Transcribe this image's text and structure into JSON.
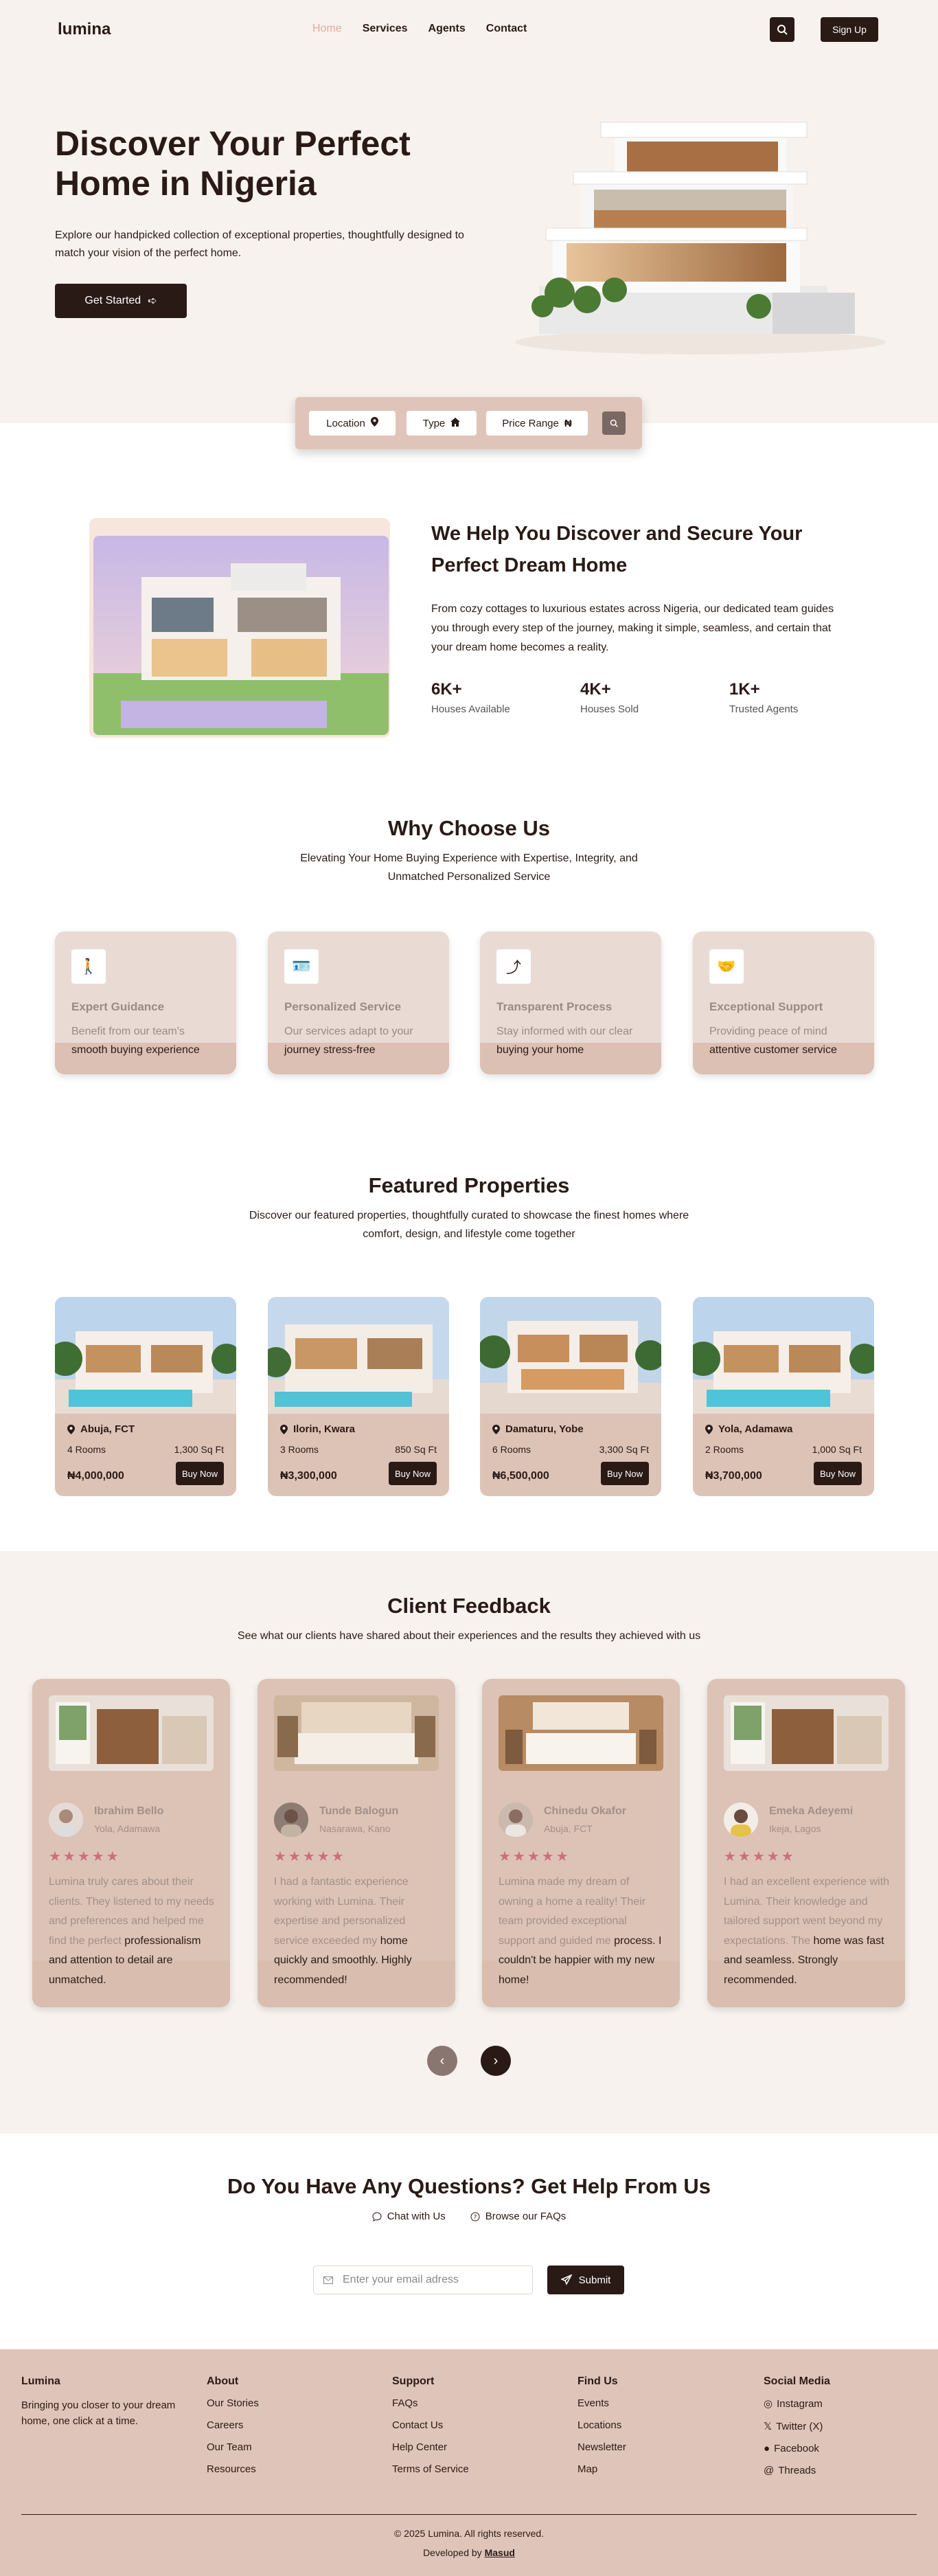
{
  "nav": {
    "logo": "lumina",
    "links": [
      "Home",
      "Services",
      "Agents",
      "Contact"
    ],
    "signup": "Sign Up"
  },
  "hero": {
    "title": "Discover Your Perfect Home in Nigeria",
    "subtitle": "Explore our handpicked collection of exceptional properties, thoughtfully designed to match your vision of the perfect home.",
    "cta": "Get Started"
  },
  "search": {
    "location": "Location",
    "type": "Type",
    "price": "Price Range"
  },
  "about": {
    "title": "We Help You Discover and Secure Your Perfect Dream Home",
    "text": "From cozy cottages to luxurious estates across Nigeria, our dedicated team guides you through every step of the journey, making it simple, seamless, and certain that your dream home becomes a reality.",
    "stats": [
      {
        "num": "6K+",
        "label": "Houses Available"
      },
      {
        "num": "4K+",
        "label": "Houses Sold"
      },
      {
        "num": "1K+",
        "label": "Trusted Agents"
      }
    ]
  },
  "why": {
    "title": "Why Choose Us",
    "subtitle": "Elevating Your Home Buying Experience with Expertise, Integrity, and Unmatched Personalized Service",
    "items": [
      {
        "title": "Expert Guidance",
        "l1": "Benefit from our team's",
        "l2": "smooth buying experience",
        "icon": "walking-arrow-icon"
      },
      {
        "title": "Personalized Service",
        "l1": "Our services adapt to your",
        "l2": "journey stress-free",
        "icon": "id-badge-icon"
      },
      {
        "title": "Transparent Process",
        "l1": "Stay informed with our clear",
        "l2": "buying your home",
        "icon": "route-icon"
      },
      {
        "title": "Exceptional Support",
        "l1": "Providing peace of mind",
        "l2": "attentive customer service",
        "icon": "handshake-icon"
      }
    ]
  },
  "featured": {
    "title": "Featured Properties",
    "subtitle": "Discover our featured properties, thoughtfully curated to showcase the finest homes where comfort, design, and lifestyle come together",
    "buy": "Buy Now",
    "items": [
      {
        "loc": "Abuja, FCT",
        "rooms": "4 Rooms",
        "sqft": "1,300 Sq Ft",
        "price": "₦4,000,000"
      },
      {
        "loc": "Ilorin, Kwara",
        "rooms": "3 Rooms",
        "sqft": "850 Sq Ft",
        "price": "₦3,300,000"
      },
      {
        "loc": "Damaturu, Yobe",
        "rooms": "6 Rooms",
        "sqft": "3,300 Sq Ft",
        "price": "₦6,500,000"
      },
      {
        "loc": "Yola, Adamawa",
        "rooms": "2 Rooms",
        "sqft": "1,000 Sq Ft",
        "price": "₦3,700,000"
      }
    ]
  },
  "feedback": {
    "title": "Client Feedback",
    "subtitle": "See what our clients have shared about their experiences and the results they achieved with us",
    "stars": "★★★★★",
    "items": [
      {
        "name": "Ibrahim Bello",
        "place": "Yola, Adamawa",
        "t1": "Lumina truly cares about their clients. They listened to my needs and preferences and helped me find the perfect",
        "t2": "professionalism and attention to detail are unmatched."
      },
      {
        "name": "Tunde Balogun",
        "place": "Nasarawa, Kano",
        "t1": "I had a fantastic experience working with Lumina. Their expertise and personalized service exceeded my",
        "t2": "home quickly and smoothly. Highly recommended!"
      },
      {
        "name": "Chinedu Okafor",
        "place": "Abuja, FCT",
        "t1": "Lumina made my dream of owning a home a reality! Their team provided exceptional support and guided me",
        "t2": "process. I couldn't be happier with my new home!"
      },
      {
        "name": "Emeka Adeyemi",
        "place": "Ikeja, Lagos",
        "t1": "I had an excellent experience with Lumina. Their knowledge and tailored support went beyond my expectations. The",
        "t2": "home was fast and seamless. Strongly recommended."
      }
    ]
  },
  "faq": {
    "title": "Do You Have Any Questions? Get Help From Us",
    "chat": "Chat with Us",
    "browse": "Browse our FAQs",
    "placeholder": "Enter your email adress",
    "submit": "Submit"
  },
  "footer": {
    "brand": "Lumina",
    "tagline": "Bringing you closer to your dream home, one click at a time.",
    "cols": [
      {
        "h": "About",
        "items": [
          "Our Stories",
          "Careers",
          "Our Team",
          "Resources"
        ]
      },
      {
        "h": "Support",
        "items": [
          "FAQs",
          "Contact Us",
          "Help Center",
          "Terms of Service"
        ]
      },
      {
        "h": "Find Us",
        "items": [
          "Events",
          "Locations",
          "Newsletter",
          "Map"
        ]
      },
      {
        "h": "Social Media",
        "items": [
          "Instagram",
          "Twitter (X)",
          "Facebook",
          "Threads"
        ]
      }
    ],
    "copy": "© 2025 Lumina. All rights reserved.",
    "dev_prefix": "Developed by",
    "dev_name": "Masud"
  },
  "colors": {
    "dark": "#2a1a16",
    "accent": "#e4a99a",
    "cream": "#f8f2ee",
    "tan": "#dcc3b6",
    "star": "#cc6f7c"
  }
}
